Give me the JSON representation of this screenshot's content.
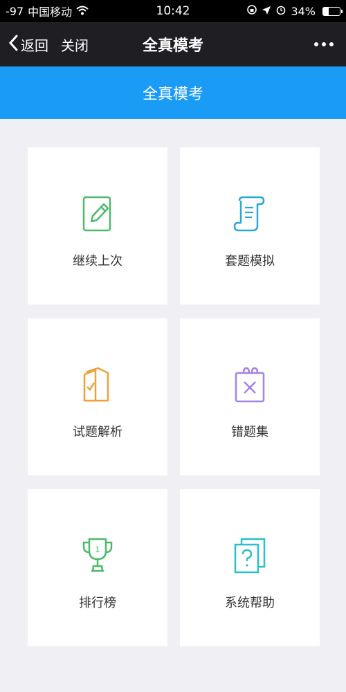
{
  "status_bar": {
    "signal": "-97",
    "carrier": "中国移动",
    "time": "10:42",
    "battery": "34%",
    "battery_level": 0.34
  },
  "nav": {
    "back_label": "返回",
    "close_label": "关闭",
    "title": "全真模考"
  },
  "header": {
    "title": "全真模考"
  },
  "tiles": [
    {
      "label": "继续上次",
      "icon": "edit-note-icon",
      "color": "#4cba6a"
    },
    {
      "label": "套题模拟",
      "icon": "scroll-icon",
      "color": "#2aa7d6"
    },
    {
      "label": "试题解析",
      "icon": "document-check-icon",
      "color": "#f0a03b"
    },
    {
      "label": "错题集",
      "icon": "wrong-notebook-icon",
      "color": "#a483e6"
    },
    {
      "label": "排行榜",
      "icon": "trophy-icon",
      "color": "#4cba6a"
    },
    {
      "label": "系统帮助",
      "icon": "help-cards-icon",
      "color": "#2ac0c6"
    }
  ]
}
